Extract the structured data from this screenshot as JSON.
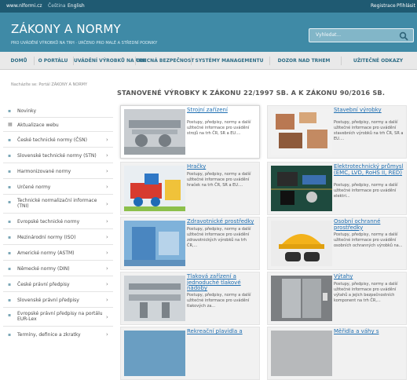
{
  "topbar": {
    "site": "www.nlformi.cz",
    "lang_cs": "Čeština",
    "lang_en": "English",
    "register": "Registrace",
    "login": "Přihlásit"
  },
  "header": {
    "logo": "ZÁKONY A NORMY",
    "tagline": "PRO UVÁDĚNÍ VÝROBKŮ NA TRH · URČENO PRO MALÉ A STŘEDNÍ PODNIKY",
    "search_placeholder": "Vyhledat..."
  },
  "nav": [
    "DOMŮ",
    "O PORTÁLU",
    "UVÁDĚNÍ VÝROBKŮ NA TRH",
    "OBECNÁ BEZPEČNOST",
    "SYSTÉMY MANAGEMENTU",
    "DOZOR NAD TRHEM",
    "UŽITEČNÉ ODKAZY"
  ],
  "breadcrumb": "Nacházíte se:  Portál ZÁKONY A NORMY",
  "main_title": "STANOVENÉ VÝROBKY K ZÁKONU 22/1997 SB. A K ZÁKONU 90/2016 SB.",
  "sidebar": [
    {
      "label": "Novinky",
      "arrow": false
    },
    {
      "label": "Aktualizace webu",
      "arrow": false
    },
    {
      "label": "České technické normy (ČSN)",
      "arrow": true
    },
    {
      "label": "Slovenské technické normy (STN)",
      "arrow": true
    },
    {
      "label": "Harmonizované normy",
      "arrow": true
    },
    {
      "label": "Určené normy",
      "arrow": true
    },
    {
      "label": "Technické normalizační informace (TNI)",
      "arrow": true
    },
    {
      "label": "Evropské technické normy",
      "arrow": true
    },
    {
      "label": "Mezinárodní normy (ISO)",
      "arrow": true
    },
    {
      "label": "Americké normy (ASTM)",
      "arrow": true
    },
    {
      "label": "Německé normy (DIN)",
      "arrow": true
    },
    {
      "label": "České právní předpisy",
      "arrow": true
    },
    {
      "label": "Slovenské právní předpisy",
      "arrow": true
    },
    {
      "label": "Evropské právní předpisy na portálu EUR-Lex",
      "arrow": true
    },
    {
      "label": "Termíny, definice a zkratky",
      "arrow": true
    }
  ],
  "cards": [
    {
      "title": "Strojní zařízení",
      "desc": "Postupy, předpisy, normy a další užitečné informace pro uvádění strojů na trh ČR, SR a EU...."
    },
    {
      "title": "Stavební výrobky",
      "desc": "Postupy, předpisy, normy a další užitečné informace pro uvádění stavebních výrobků na trh ČR, SR a EU...."
    },
    {
      "title": "Hračky",
      "desc": "Postupy, předpisy, normy a další užitečné informace pro uvádění hraček na trh ČR, SR a EU...."
    },
    {
      "title": "Elektrotechnický průmysl (EMC, LVD, RoHS II, RED)",
      "desc": "Postupy, předpisy, normy a další užitečné informace pro uvádění elektri..."
    },
    {
      "title": "Zdravotnické prostředky",
      "desc": "Postupy, předpisy, normy a další užitečné informace pro uvádění zdravotnických výrobků na trh ČR,..."
    },
    {
      "title": "Osobní ochranné prostředky",
      "desc": "Postupy, předpisy, normy a další užitečné informace pro uvádění osobních ochranných výrobků na..."
    },
    {
      "title": "Tlaková zařízení a jednoduché tlakové nádoby",
      "desc": "Postupy, předpisy, normy a další užitečné informace pro uvádění tlakových za..."
    },
    {
      "title": "Výtahy",
      "desc": "Postupy, předpisy, normy a další užitečné informace pro uvádění výtahů a jejich bezpečnostních komponent na trh ČR,..."
    },
    {
      "title": "Rekreační plavidla a",
      "desc": ""
    },
    {
      "title": "Měřidla a váhy s",
      "desc": ""
    }
  ]
}
